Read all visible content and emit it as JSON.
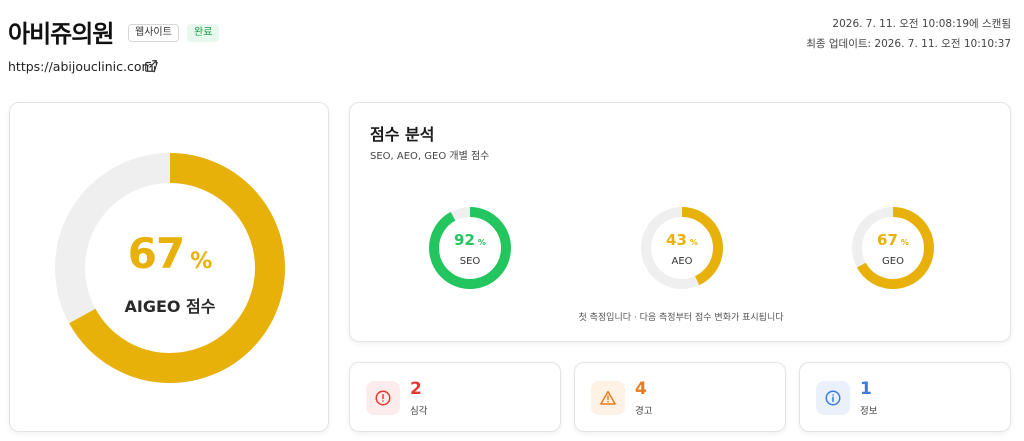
{
  "header": {
    "title": "아비쥬의원",
    "tag_type": "웹사이트",
    "tag_status": "완료",
    "url": "https://abijouclinic.com/",
    "scanned_at": "2026. 7. 11. 오전 10:08:19에 스캔됨",
    "updated_at": "최종 업데이트: 2026. 7. 11. 오전 10:10:37"
  },
  "overall": {
    "score": 67,
    "percent_sign": "%",
    "label": "AIGEO 점수",
    "color": "#E8B10A",
    "track_color": "#EFEFEF"
  },
  "analysis": {
    "title": "점수 분석",
    "subtitle": "SEO, AEO, GEO 개별 점수",
    "note": "첫 측정입니다 · 다음 측정부터 점수 변화가 표시됩니다",
    "scores": [
      {
        "label": "SEO",
        "value": 92,
        "percent_sign": "%",
        "color": "#22C55E"
      },
      {
        "label": "AEO",
        "value": 43,
        "percent_sign": "%",
        "color": "#E8B10A"
      },
      {
        "label": "GEO",
        "value": 67,
        "percent_sign": "%",
        "color": "#E8B10A"
      }
    ]
  },
  "issues": {
    "critical": {
      "count": "2",
      "label": "심각",
      "color": "#E53935",
      "bg": "#FDECEC",
      "icon": "alert-circle-icon"
    },
    "warning": {
      "count": "4",
      "label": "경고",
      "color": "#F07B16",
      "bg": "#FEF1E6",
      "icon": "alert-triangle-icon"
    },
    "info": {
      "count": "1",
      "label": "정보",
      "color": "#3B7DDD",
      "bg": "#EAF1FC",
      "icon": "info-circle-icon"
    }
  }
}
